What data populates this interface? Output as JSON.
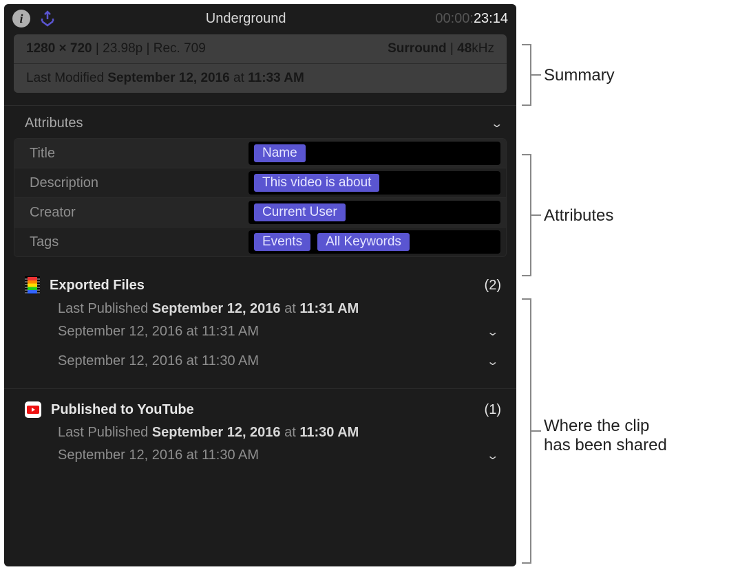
{
  "header": {
    "title": "Underground",
    "timecode_dim": "00:00:",
    "timecode_bright": "23:14"
  },
  "summary": {
    "resolution": "1280 × 720",
    "sep1": " | ",
    "frame_rate": "23.98p",
    "sep2": " | ",
    "color_space": "Rec. 709",
    "audio_label": "Surround",
    "audio_sep": " | ",
    "audio_rate_num": "48",
    "audio_rate_unit": "kHz",
    "modified_prefix": "Last Modified ",
    "modified_date": "September 12, 2016",
    "modified_mid": " at ",
    "modified_time": "11:33 AM"
  },
  "attributes": {
    "section_label": "Attributes",
    "rows": [
      {
        "label": "Title",
        "tokens": [
          "Name"
        ]
      },
      {
        "label": "Description",
        "tokens": [
          "This video is about"
        ]
      },
      {
        "label": "Creator",
        "tokens": [
          "Current User"
        ]
      },
      {
        "label": "Tags",
        "tokens": [
          "Events",
          "All Keywords"
        ]
      }
    ]
  },
  "share": [
    {
      "icon": "film",
      "title": "Exported Files",
      "count": "(2)",
      "last_prefix": "Last Published ",
      "last_date": "September 12, 2016",
      "last_mid": " at ",
      "last_time": "11:31 AM",
      "items": [
        "September 12, 2016 at 11:31 AM",
        "September 12, 2016 at 11:30 AM"
      ]
    },
    {
      "icon": "youtube",
      "title": "Published to YouTube",
      "count": "(1)",
      "last_prefix": "Last Published ",
      "last_date": "September 12, 2016",
      "last_mid": " at ",
      "last_time": "11:30 AM",
      "items": [
        "September 12, 2016 at 11:30 AM"
      ]
    }
  ],
  "annotations": {
    "summary": "Summary",
    "attributes": "Attributes",
    "shared": "Where the clip\nhas been shared"
  }
}
